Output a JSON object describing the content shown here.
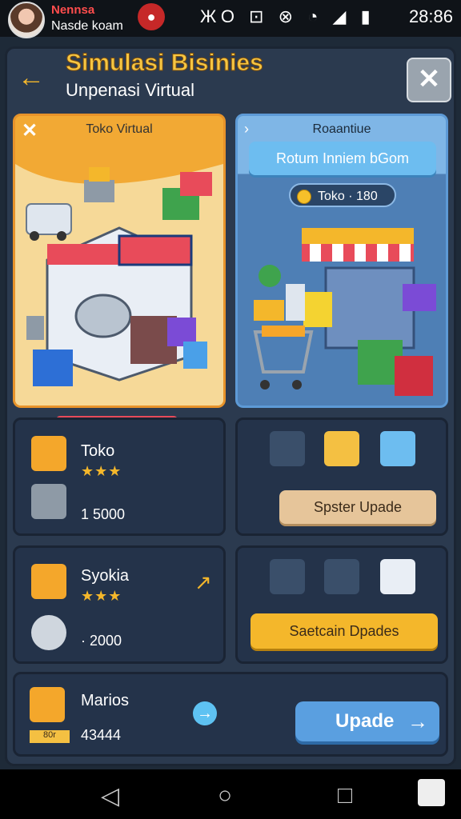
{
  "status_bar": {
    "notification_name": "Nennsa",
    "notification_text": "Nasde koam",
    "icons": "ЖО ⊡ ⊗ ◔ ◢ ▮",
    "time": "28:86"
  },
  "header": {
    "title": "Simulasi Bisinies",
    "subtitle": "Unpenasi Virtual"
  },
  "card_left": {
    "label": "Toko Virtual"
  },
  "card_right": {
    "label": "Roaantiue",
    "button": "Rotum Inniem bGom",
    "coin_label": "Toko · 180"
  },
  "tiles": {
    "toko": {
      "name": "Toko",
      "stars": "★★★",
      "value": "1 5000"
    },
    "upgrade_1": {
      "button": "Spster Upade"
    },
    "syokia": {
      "name": "Syokia",
      "stars": "★★★",
      "value": "· 2000"
    },
    "upgrade_2": {
      "button": "Saetcain Dpades"
    },
    "marios": {
      "name": "Marios",
      "badge": "80r",
      "value": "43444",
      "button": "Upade"
    }
  },
  "colors": {
    "accent_yellow": "#f4b72b",
    "accent_blue": "#5a9fe0",
    "panel": "#2b3a4f"
  }
}
